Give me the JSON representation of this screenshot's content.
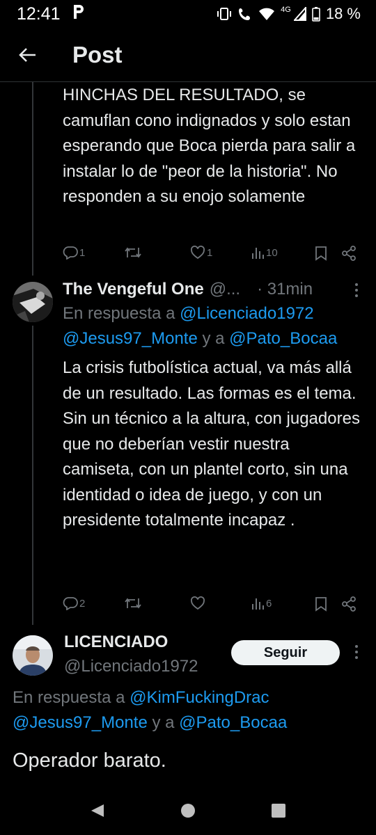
{
  "status_bar": {
    "time": "12:41",
    "network": "4G",
    "battery": "18 %"
  },
  "header": {
    "title": "Post"
  },
  "tweet1": {
    "text": "HINCHAS DEL RESULTADO, se camuflan cono indignados y solo estan esperando que Boca pierda para salir a instalar lo de \"peor de la historia\". No responden a su enojo solamente",
    "replies": "1",
    "likes": "1",
    "views": "10"
  },
  "tweet2": {
    "name": "The Vengeful One",
    "handle": "@...",
    "time": "· 31min",
    "reply_prefix": "En respuesta a ",
    "reply_user1": "@Licenciado1972",
    "reply_user2": "@Jesus97_Monte",
    "reply_and": " y a ",
    "reply_user3": "@Pato_Bocaa",
    "text": "La crisis futbolística actual, va más allá de un resultado. Las formas es el tema. Sin un técnico a la altura, con jugadores que no deberían vestir nuestra camiseta, con un plantel corto, sin una identidad o idea de juego, y con un presidente totalmente incapaz .",
    "replies": "2",
    "views": "6"
  },
  "tweet3": {
    "name": "LICENCIADO",
    "handle": "@Licenciado1972",
    "follow_label": "Seguir",
    "reply_prefix": "En respuesta a ",
    "reply_user1": "@KimFuckingDrac",
    "reply_user2": "@Jesus97_Monte",
    "reply_and": " y a ",
    "reply_user3": "@Pato_Bocaa",
    "text": "Operador barato."
  },
  "colors": {
    "background": "#000000",
    "text": "#e7e9ea",
    "muted": "#71767b",
    "link": "#1d9bf0"
  }
}
